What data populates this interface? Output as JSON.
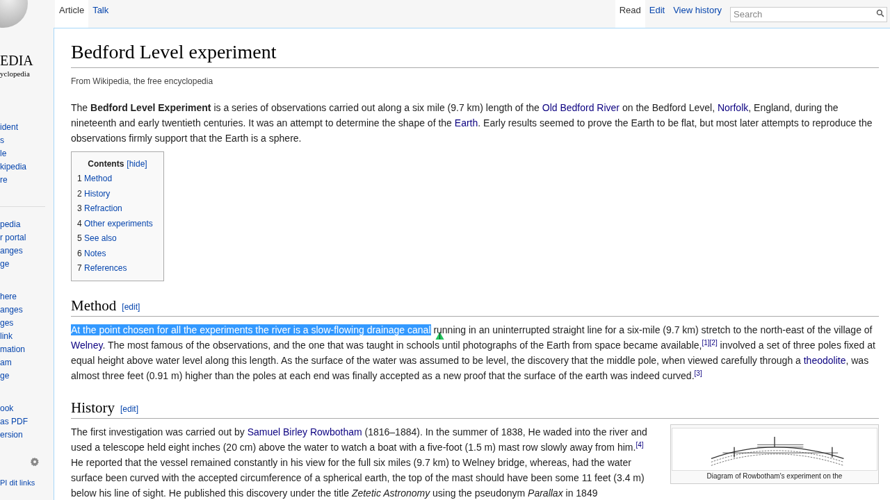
{
  "logo": {
    "wordmark": "EDIA",
    "tagline": "yclopedia"
  },
  "sidebar": {
    "groups": [
      {
        "items": [
          "ident",
          "s",
          "le",
          "kipedia",
          "re"
        ]
      },
      {
        "items": [
          "pedia",
          "r portal",
          "anges",
          "ge"
        ]
      },
      {
        "items": [
          "here",
          "anges",
          "ges",
          "link",
          "mation",
          "am",
          "ge"
        ]
      },
      {
        "items": [
          "ook",
          "as PDF",
          "ersion"
        ]
      }
    ],
    "footer_link": "PI dit links"
  },
  "tabs": [
    {
      "label": "Article",
      "selected": true
    },
    {
      "label": "Talk",
      "selected": false
    }
  ],
  "views": [
    {
      "label": "Read",
      "selected": true
    },
    {
      "label": "Edit",
      "selected": false
    },
    {
      "label": "View history",
      "selected": false
    }
  ],
  "search": {
    "placeholder": "Search"
  },
  "title": "Bedford Level experiment",
  "subtitle": "From Wikipedia, the free encyclopedia",
  "intro": [
    {
      "kind": "text",
      "text": "The "
    },
    {
      "kind": "bold",
      "text": "Bedford Level Experiment"
    },
    {
      "kind": "text",
      "text": " is a series of observations carried out along a six mile (9.7 km) length of the "
    },
    {
      "kind": "link",
      "text": "Old Bedford River"
    },
    {
      "kind": "text",
      "text": " on the Bedford Level, "
    },
    {
      "kind": "link",
      "text": "Norfolk"
    },
    {
      "kind": "text",
      "text": ", England, during the nineteenth and early twentieth centuries. It was an attempt to determine the shape of the "
    },
    {
      "kind": "link",
      "text": "Earth"
    },
    {
      "kind": "text",
      "text": ". Early results seemed to prove the Earth to be flat, but most later attempts to reproduce the observations firmly support that the Earth is a sphere."
    }
  ],
  "toc": {
    "title": "Contents",
    "toggle": "[hide]",
    "items": [
      {
        "number": "1",
        "label": "Method"
      },
      {
        "number": "2",
        "label": "History"
      },
      {
        "number": "3",
        "label": "Refraction"
      },
      {
        "number": "4",
        "label": "Other experiments"
      },
      {
        "number": "5",
        "label": "See also"
      },
      {
        "number": "6",
        "label": "Notes"
      },
      {
        "number": "7",
        "label": "References"
      }
    ]
  },
  "sections": [
    {
      "heading": "Method",
      "edit": "[edit]",
      "paragraph": [
        {
          "kind": "highlighted",
          "text": "At the point chosen for all the experiments the river is a slow-flowing drainage canal"
        },
        {
          "kind": "text",
          "text": " running in an uninterrupted straight line for a six-mile (9.7 km) stretch to the north-east of the village of "
        },
        {
          "kind": "link",
          "text": "Welney"
        },
        {
          "kind": "text",
          "text": ". The most famous of the observations, and the one that was taught in schools until photographs of the Earth from space became available,"
        },
        {
          "kind": "ref",
          "text": "[1]"
        },
        {
          "kind": "ref",
          "text": "[2]"
        },
        {
          "kind": "text",
          "text": " involved a set of three poles fixed at equal height above water level along this length. As the surface of the water was assumed to be level, the discovery that the middle pole, when viewed carefully through a "
        },
        {
          "kind": "link",
          "text": "theodolite"
        },
        {
          "kind": "text",
          "text": ", was almost three feet (0.91 m) higher than the poles at each end was finally accepted as a new proof that the surface of the earth was indeed curved."
        },
        {
          "kind": "ref",
          "text": "[3]"
        }
      ]
    },
    {
      "heading": "History",
      "edit": "[edit]",
      "figure": {
        "kind": "diagram",
        "caption": "Diagram of Rowbotham's experiment on the"
      },
      "paragraph": [
        {
          "kind": "text",
          "text": "The first investigation was carried out by "
        },
        {
          "kind": "link",
          "text": "Samuel Birley Rowbotham"
        },
        {
          "kind": "text",
          "text": " (1816–1884). In the summer of 1838, He waded into the river and used a telescope held eight inches (20 cm) above the water to watch a boat with a five-foot (1.5 m) mast row slowly away from him."
        },
        {
          "kind": "ref",
          "text": "[4]"
        },
        {
          "kind": "text",
          "text": " He reported that the vessel remained constantly in his view for the full six miles (9.7 km) to Welney bridge, whereas, had the water surface been curved with the accepted circumference of a spherical earth, the top of the mast should have been some 11 feet (3.4 m) below his line of sight. He published this discovery under the title "
        },
        {
          "kind": "italic",
          "text": "Zetetic Astronomy"
        },
        {
          "kind": "text",
          "text": " using the pseudonym "
        },
        {
          "kind": "italic",
          "text": "Parallax"
        },
        {
          "kind": "text",
          "text": " in 1849"
        }
      ]
    }
  ]
}
